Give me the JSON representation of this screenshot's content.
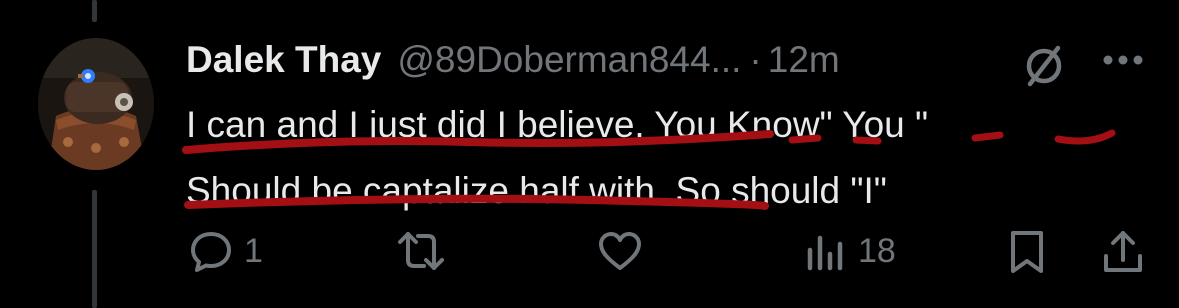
{
  "tweet": {
    "author": {
      "display_name": "Dalek Thay",
      "handle": "@89Doberman844...",
      "avatar_icon": "dalek-avatar"
    },
    "separator": "·",
    "timestamp": "12m",
    "text_lines": [
      "I can and I just did I believe. You Know\" You \"",
      "Should be captalize half with. So should \"I\""
    ],
    "actions": {
      "replies": "1",
      "retweets": "",
      "likes": "",
      "views": "18"
    },
    "icons": {
      "reply": "comment-bubble-icon",
      "retweet": "retweet-arrows-icon",
      "like": "heart-icon",
      "views": "bar-chart-icon",
      "bookmark": "bookmark-icon",
      "share": "share-upload-icon",
      "grok": "grok-slash-circle-icon",
      "more": "ellipsis-icon"
    }
  },
  "colors": {
    "background": "#000000",
    "primary_text": "#e7e9ea",
    "secondary_text": "#71767b",
    "thread_line": "#333639",
    "annotation_red": "#a40f14"
  }
}
